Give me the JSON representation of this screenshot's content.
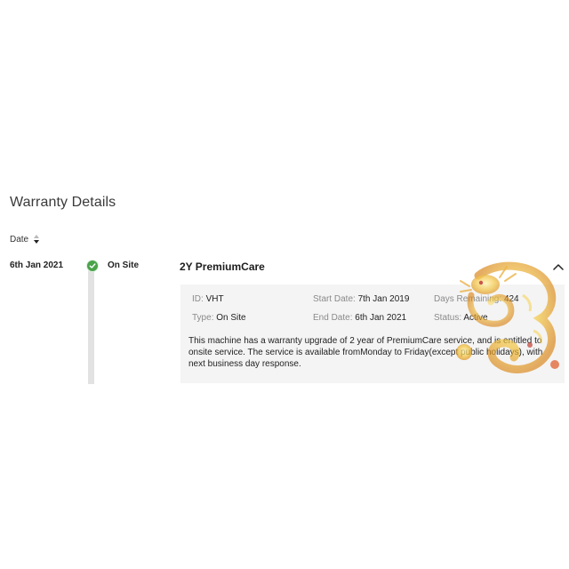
{
  "header": {
    "title": "Warranty Details"
  },
  "sort": {
    "label": "Date"
  },
  "entry": {
    "date": "6th Jan 2021",
    "status_type": "On Site",
    "plan_name": "2Y PremiumCare",
    "details": {
      "id_label": "ID",
      "id_value": "VHT",
      "type_label": "Type",
      "type_value": "On Site",
      "start_label": "Start Date",
      "start_value": "7th Jan 2019",
      "end_label": "End Date",
      "end_value": "6th Jan 2021",
      "days_label": "Days Remaining",
      "days_value": "424",
      "status_label": "Status",
      "status_value": "Active",
      "description": "This machine has a warranty upgrade of 2 year of PremiumCare service, and is entitled to onsite service. The service is available fromMonday to Friday(except public holidays), with next business day response."
    }
  },
  "colors": {
    "status_ok": "#4aa34a",
    "panel_bg": "#f4f4f4",
    "timeline": "#e2e2e2"
  },
  "icons": {
    "status": "check-circle-icon",
    "collapse": "chevron-up-icon",
    "sort": "sort-arrows-icon",
    "watermark": "dragon-watermark"
  }
}
